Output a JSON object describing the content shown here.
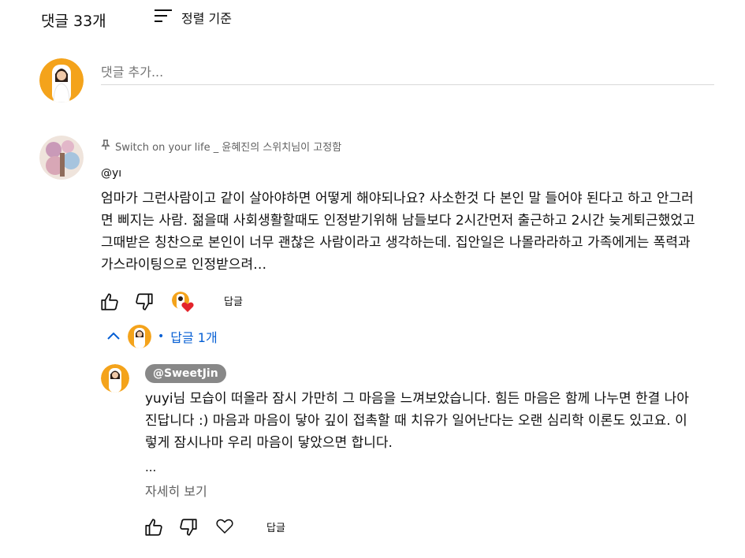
{
  "header": {
    "comment_count": "댓글 33개",
    "sort_label": "정렬 기준"
  },
  "add_comment": {
    "placeholder": "댓글 추가..."
  },
  "comment": {
    "pinned_text": "Switch on your life _ 윤혜진의 스위치님이 고정함",
    "author": "@yı",
    "text": "엄마가 그런사람이고 같이 살아야하면 어떻게 해야되나요? 사소한것 다 본인 말 들어야 된다고 하고 안그러면 삐지는 사람. 젊을때 사회생활할때도 인정받기위해 남들보다 2시간먼저 출근하고 2시간 늦게퇴근했었고 그때받은 칭찬으로 본인이 너무 괜찮은 사람이라고 생각하는데. 집안일은 나몰라라하고 가족에게는 폭력과 가스라이팅으로 인정받으려…",
    "reply_label": "답글",
    "replies_toggle": "답글 1개",
    "replies_dot": "•"
  },
  "reply": {
    "handle": "@SweetJin",
    "text": "yuyi님 모습이 떠올라 잠시 가만히 그 마음을 느껴보았습니다. 힘든 마음은 함께 나누면 한결 나아진답니다 :) 마음과 마음이 닿아 깊이 접촉할 때 치유가 일어난다는 오랜 심리학 이론도 있고요. 이렇게 잠시나마 우리 마음이 닿았으면 합니다.",
    "ellipsis": "...",
    "more_label": "자세히 보기",
    "reply_label": "답글"
  },
  "colors": {
    "link_blue": "#065fd4",
    "heart_red": "#e3242b",
    "badge_gray": "#888888",
    "secondary_text": "#606060"
  },
  "icons": [
    "sort-icon",
    "pin-icon",
    "like-icon",
    "dislike-icon",
    "creator-heart-icon",
    "chevron-up-icon",
    "heart-outline-icon"
  ]
}
